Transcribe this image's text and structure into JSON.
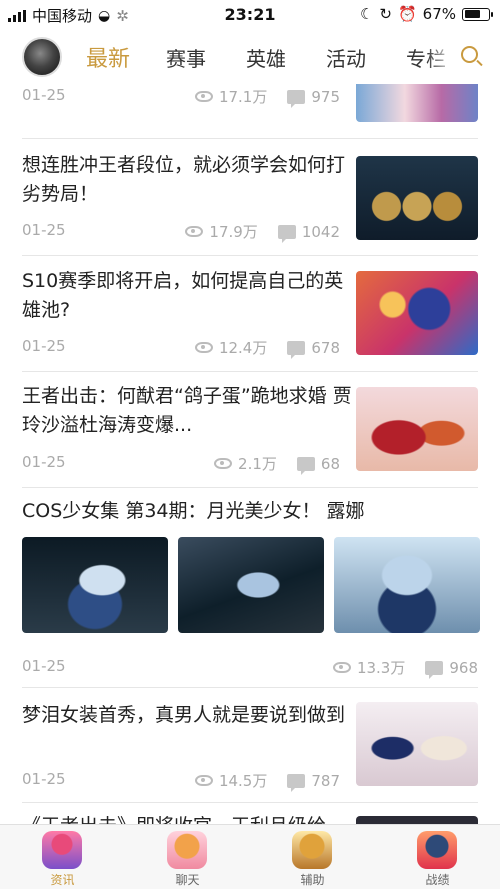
{
  "status_bar": {
    "carrier": "中国移动",
    "time": "23:21",
    "battery": "67%",
    "battery_level": 0.67
  },
  "nav": {
    "tabs": [
      {
        "label": "最新",
        "active": true
      },
      {
        "label": "赛事",
        "active": false
      },
      {
        "label": "英雄",
        "active": false
      },
      {
        "label": "活动",
        "active": false
      },
      {
        "label": "专栏",
        "active": false
      }
    ],
    "accent_color": "#c99a3f"
  },
  "feed": {
    "items": [
      {
        "title": "",
        "date": "01-25",
        "views": "17.1万",
        "comments": "975",
        "thumbnail": "banner"
      },
      {
        "title": "想连胜冲王者段位，就必须学会如何打劣势局！",
        "date": "01-25",
        "views": "17.9万",
        "comments": "1042",
        "thumbnail": "rank-badges"
      },
      {
        "title": "S10赛季即将开启，如何提高自己的英雄池?",
        "date": "01-25",
        "views": "12.4万",
        "comments": "678",
        "thumbnail": "hero-art"
      },
      {
        "title": "王者出击：何猷君“鸽子蛋”跪地求婚 贾玲沙溢杜海涛变爆...",
        "date": "01-25",
        "views": "2.1万",
        "comments": "68",
        "thumbnail": "couple-photo"
      },
      {
        "title": "COS少女集 第34期：月光美少女！ 露娜",
        "date": "01-25",
        "views": "13.3万",
        "comments": "968",
        "thumbnail": "cosplay-gallery"
      },
      {
        "title": "梦泪女装首秀，真男人就是要说到做到",
        "date": "01-25",
        "views": "14.5万",
        "comments": "787",
        "thumbnail": "costume-photo"
      },
      {
        "title": "《王者出击》即将收官，王利旦级给",
        "date": "",
        "views": "",
        "comments": "",
        "thumbnail": "dark"
      }
    ]
  },
  "tabbar": {
    "items": [
      {
        "label": "资讯",
        "active": true,
        "icon": "news-icon"
      },
      {
        "label": "聊天",
        "active": false,
        "icon": "chat-icon"
      },
      {
        "label": "辅助",
        "active": false,
        "icon": "assist-icon"
      },
      {
        "label": "战绩",
        "active": false,
        "icon": "record-icon"
      }
    ]
  }
}
